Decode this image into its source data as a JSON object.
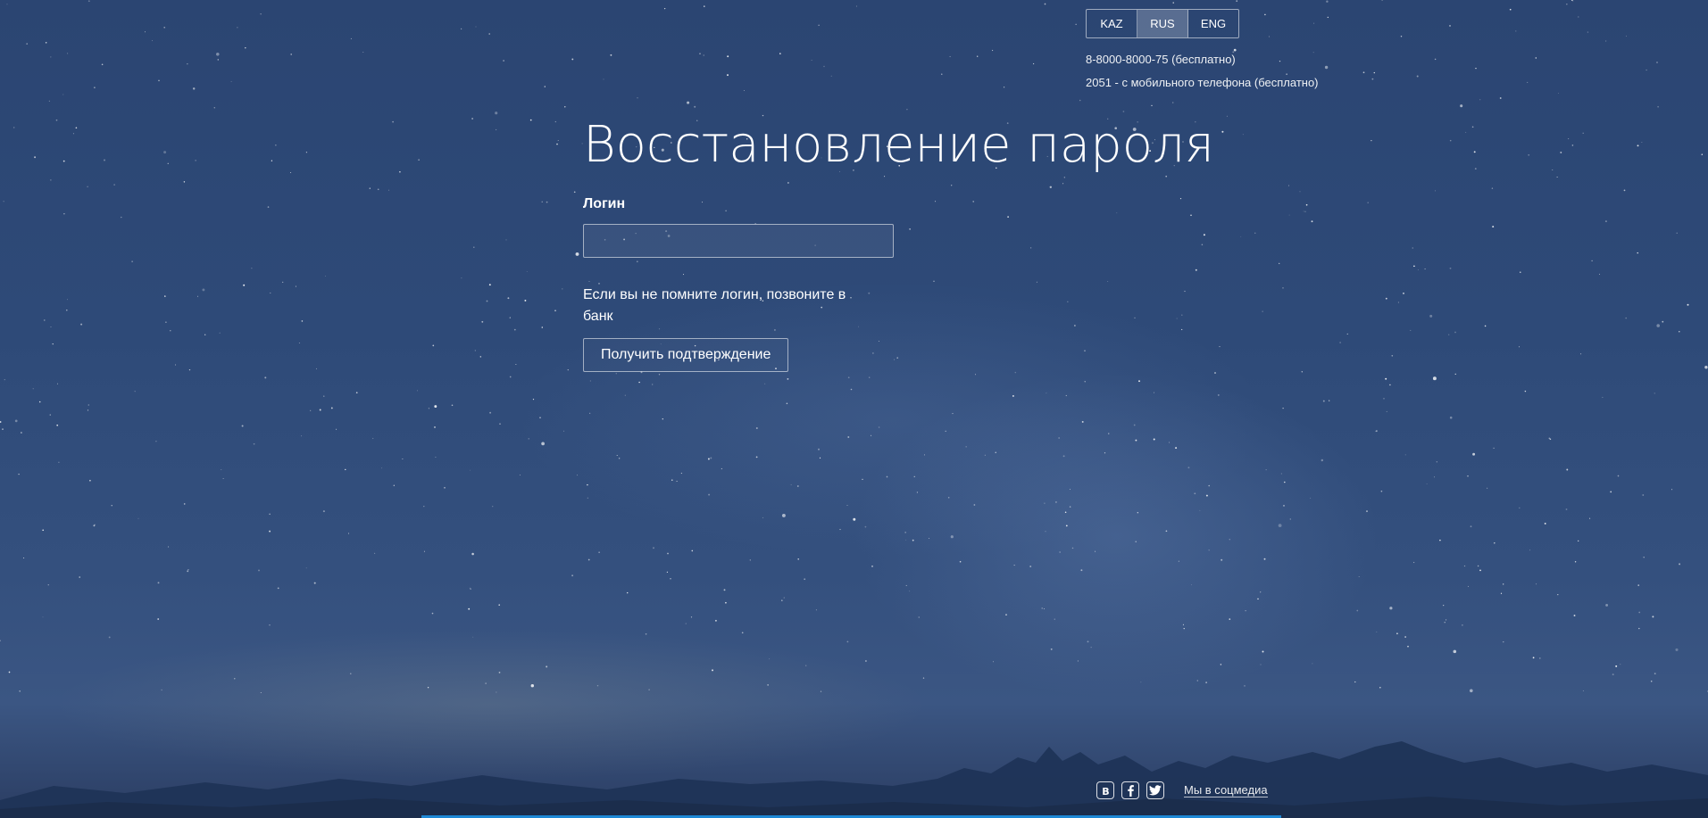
{
  "header": {
    "languages": [
      {
        "label": "KAZ",
        "active": false
      },
      {
        "label": "RUS",
        "active": true
      },
      {
        "label": "ENG",
        "active": false
      }
    ],
    "contacts": [
      "8-8000-8000-75 (бесплатно)",
      "2051 - с мобильного телефона (бесплатно)"
    ]
  },
  "form": {
    "title": "Восстановление пароля",
    "login_label": "Логин",
    "login_value": "",
    "login_placeholder": "",
    "hint": "Если вы не помните логин, позвоните в банк",
    "submit_label": "Получить подтверждение"
  },
  "footer": {
    "social_icons": [
      "vk-icon",
      "facebook-icon",
      "twitter-icon"
    ],
    "social_link": "Мы в соцмедиа"
  },
  "colors": {
    "background": "#2e4a78",
    "accent_bar": "#1e88d6",
    "text": "#ffffff"
  }
}
